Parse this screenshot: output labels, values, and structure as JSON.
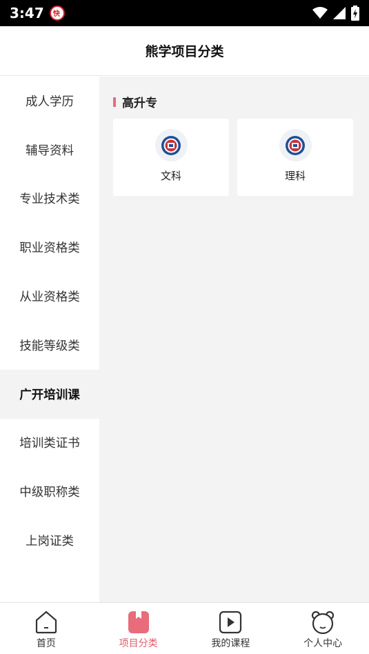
{
  "status_bar": {
    "time": "3:47",
    "badge": "⾕"
  },
  "header": {
    "title": "熊学项目分类"
  },
  "sidebar": {
    "items": [
      {
        "label": "成人学历"
      },
      {
        "label": "辅导资料"
      },
      {
        "label": "专业技术类"
      },
      {
        "label": "职业资格类"
      },
      {
        "label": "从业资格类"
      },
      {
        "label": "技能等级类"
      },
      {
        "label": "广开培训课"
      },
      {
        "label": "培训类证书"
      },
      {
        "label": "中级职称类"
      },
      {
        "label": "上岗证类"
      }
    ],
    "active_index": 6
  },
  "main": {
    "section_title": "高升专",
    "cards": [
      {
        "label": "文科"
      },
      {
        "label": "理科"
      }
    ]
  },
  "tab_bar": {
    "tabs": [
      {
        "label": "首页",
        "icon": "home-icon"
      },
      {
        "label": "项目分类",
        "icon": "bookmark-icon"
      },
      {
        "label": "我的课程",
        "icon": "play-icon"
      },
      {
        "label": "个人中心",
        "icon": "bear-face-icon"
      }
    ],
    "active_index": 1
  },
  "colors": {
    "accent": "#e05c6c",
    "content_bg": "#f3f3f3"
  }
}
